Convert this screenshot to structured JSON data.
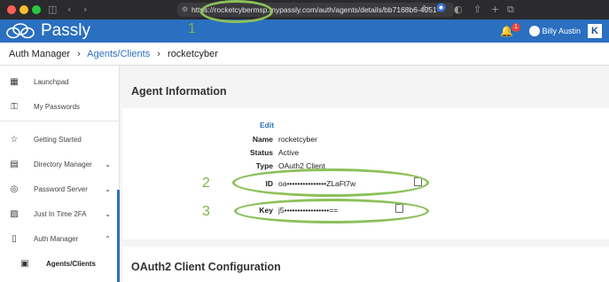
{
  "browser": {
    "url": "https://rocketcybermsp.mypassly.com/auth/agents/details/bb7168b6-4951-",
    "dots": [
      "#ff5f57",
      "#febc2e",
      "#28c840"
    ]
  },
  "header": {
    "brand": "Passly",
    "notification_count": "1",
    "user_name": "Billy Austin",
    "bg_color": "#2a6fc0"
  },
  "breadcrumb": {
    "root": "Auth Manager",
    "section": "Agents/Clients",
    "current": "rocketcyber",
    "sep": "›"
  },
  "sidebar": {
    "items": [
      {
        "label": "Launchpad",
        "icon": "grid-icon"
      },
      {
        "label": "My Passwords",
        "icon": "lock-icon"
      },
      {
        "label": "Getting Started",
        "icon": "star-icon"
      },
      {
        "label": "Directory Manager",
        "icon": "directory-icon"
      },
      {
        "label": "Password Server",
        "icon": "fingerprint-icon"
      },
      {
        "label": "Just In Time 2FA",
        "icon": "id-card-icon"
      },
      {
        "label": "Auth Manager",
        "icon": "mobile-icon"
      },
      {
        "label": "Agents/Clients",
        "icon": "devices-icon"
      }
    ]
  },
  "main": {
    "agent_info_title": "Agent Information",
    "edit_label": "Edit",
    "fields": {
      "name_label": "Name",
      "name_value": "rocketcyber",
      "status_label": "Status",
      "status_value": "Active",
      "type_label": "Type",
      "type_value": "OAuth2 Client",
      "id_label": "ID",
      "id_value": "oa•••••••••••••••ZLaFt7w",
      "key_label": "Key",
      "key_value": "j5•••••••••••••••••=="
    },
    "oauth_title": "OAuth2 Client Configuration"
  },
  "annotations": {
    "one": "1",
    "two": "2",
    "three": "3",
    "color": "#8cc05a"
  }
}
